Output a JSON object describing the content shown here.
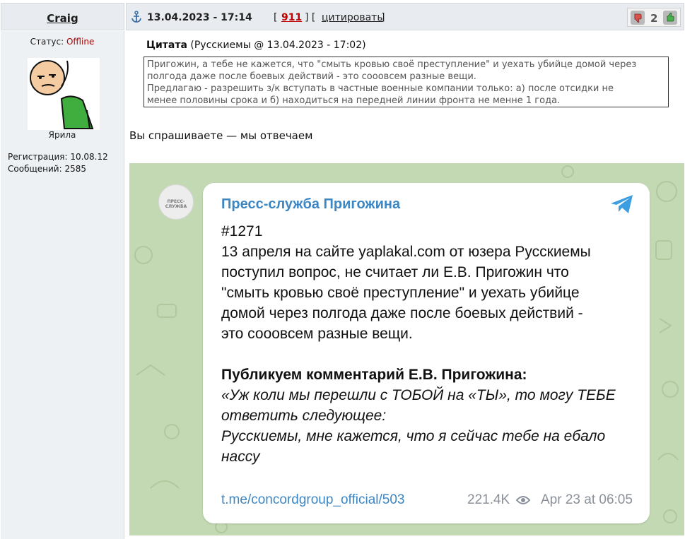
{
  "user": {
    "name": "Craig",
    "status_label": "Статус:",
    "status_value": "Offline",
    "rank": "Ярила",
    "registration": "Регистрация: 10.08.12",
    "messages": "Сообщений: 2585"
  },
  "post": {
    "date": "13.04.2023 - 17:14",
    "number": "911",
    "bracket_open": "[",
    "bracket_mid": "] [",
    "bracket_close": "]",
    "quote_action": "цитировать",
    "rating": "2",
    "reply": "Вы спрашиваете — мы отвечаем"
  },
  "quote": {
    "label": "Цитата",
    "meta": "(Русскиемы @ 13.04.2023 - 17:02)",
    "lines": [
      "Пригожин, а тебе не кажется, что \"смыть кровью своё преступление\" и уехать убийце домой через",
      "полгода даже после боевых действий - это сооовсем разные вещи.",
      "Предлагаю - разрешить з/к вступать в частные военные компании только: а) после отсидки не",
      "менее половины срока и б) находиться на передней линии фронта не менне 1 года."
    ]
  },
  "telegram": {
    "avatar_text": "ПРЕСС-СЛУЖБА",
    "channel": "Пресс-служба Пригожина",
    "paragraph1": [
      "#1271",
      "13 апреля на сайте yaplakal.com от юзера Русскиемы",
      "поступил вопрос, не считает ли Е.В. Пригожин что",
      "\"смыть кровью своё преступление\" и уехать убийце",
      "домой через полгода даже после боевых действий -",
      "это сооовсем разные вещи."
    ],
    "bold_heading": "Публикуем комментарий Е.В. Пригожина:",
    "italic_lines": [
      "«Уж коли мы перешли с ТОБОЙ на «ТЫ», то могу ТЕБЕ",
      "ответить следующее:",
      "Русскиемы, мне кажется, что я сейчас тебе на ебало",
      "нассу"
    ],
    "link": "t.me/concordgroup_official/503",
    "views": "221.4K",
    "time": "Apr 23 at 06:05"
  },
  "colors": {
    "header_bg": "#e8ebef",
    "post_number": "#c00000",
    "offline": "#b00000",
    "telegram_blue": "#3c86c4",
    "telegram_bg": "#c3d9b3"
  },
  "icons": [
    "anchor-icon",
    "thumb-down-icon",
    "thumb-up-icon",
    "telegram-plane-icon",
    "eye-icon"
  ]
}
